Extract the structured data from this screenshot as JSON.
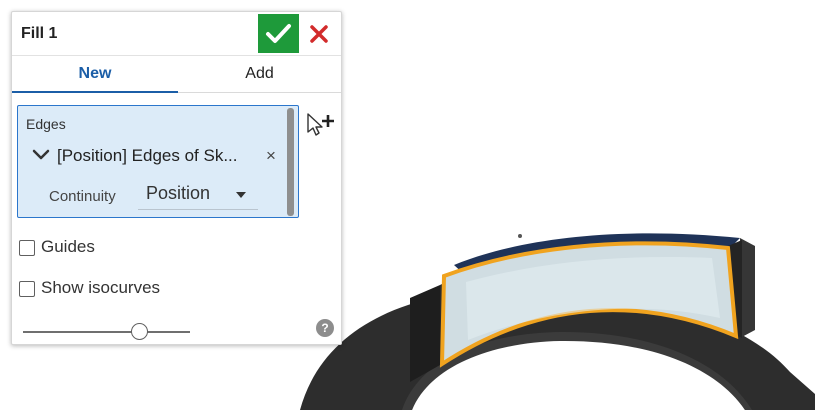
{
  "dialog": {
    "title": "Fill 1",
    "confirm_icon": "check-icon",
    "cancel_icon": "close-icon",
    "colors": {
      "confirm": "#1e9a3a",
      "cancel": "#d22b2b",
      "accent": "#1b5ea7",
      "selection_bg": "#dcebf8",
      "edge_highlight": "#f0a31f"
    }
  },
  "tabs": [
    {
      "label": "New",
      "active": true
    },
    {
      "label": "Add",
      "active": false
    }
  ],
  "edges": {
    "label": "Edges",
    "item_text": "[Position] Edges of Sk...",
    "remove_glyph": "×",
    "continuity_label": "Continuity",
    "continuity_value": "Position"
  },
  "options": {
    "guides_label": "Guides",
    "guides_checked": false,
    "isocurves_label": "Show isocurves",
    "isocurves_checked": false,
    "slider_level": 0.69
  },
  "help": {
    "glyph": "?",
    "icon": "help-icon"
  },
  "selection_cursor_icon": "add-selection-cursor-icon"
}
